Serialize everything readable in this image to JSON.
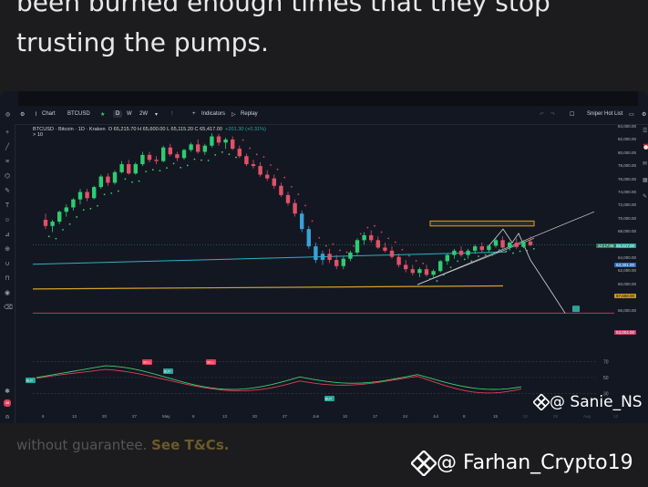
{
  "article": {
    "line1": "been burned enough times that they stop",
    "line2": "trusting the pumps.",
    "disclaimer_text": "without guarantee. ",
    "disclaimer_link": "See T&Cs."
  },
  "toolbar": {
    "chart_label": "Chart",
    "symbol": "BTCUSD",
    "interval_d": "D",
    "interval_w": "W",
    "interval_2w": "2W",
    "indicators_label": "Indicators",
    "replay_label": "Replay",
    "watchlist_label": "Sniper Hot List"
  },
  "legend": {
    "title": "BTCUSD · Bitcoin · 1D · Kraken",
    "ohlc": "O 65,215.70 H 65,600.00 L 65,115.20 C 65,417.00",
    "change": "+201.30 (+0.31%)",
    "sub": "> 10"
  },
  "price_axis": {
    "ticks": [
      "84,000.00",
      "82,000.00",
      "80,000.00",
      "78,000.00",
      "76,000.00",
      "74,000.00",
      "72,000.00",
      "70,000.00",
      "68,000.00",
      "66,000.00",
      "64,000.00",
      "62,000.00",
      "60,000.00",
      "58,000.00",
      "56,000.00"
    ],
    "tag_current": "65,417.00",
    "tag_green": "22:17:06",
    "tag_blue": "63,301.00",
    "tag_yellow": "57,658.00",
    "tag_pink": "53,004.00"
  },
  "osc_axis": {
    "ticks": [
      "70",
      "50",
      "30"
    ]
  },
  "osc_labels": {
    "sell1": "SELL",
    "sell2": "SELL",
    "buy1": "BUY",
    "buy2": "BUY",
    "buy3": "BUY"
  },
  "time_axis": {
    "labels": [
      "6",
      "13",
      "20",
      "27",
      "May",
      "6",
      "13",
      "20",
      "27",
      "Jun",
      "10",
      "17",
      "24",
      "Jul",
      "8",
      "15",
      "22",
      "29",
      "Aug",
      "12"
    ]
  },
  "watermarks": {
    "small": "@ Sanie_NS",
    "large": "@ Farhan_Crypto19"
  },
  "colors": {
    "up": "#26a69a",
    "down": "#ef5350",
    "bull_candle": "#2ecc71",
    "bear_candle": "#e05268",
    "trend_blue": "#2bb3c0",
    "support_yellow": "#d4a22a",
    "dots_red": "#e0405a",
    "dots_green": "#3ecf6a"
  },
  "chart_data": {
    "type": "candlestick",
    "title": "BTCUSD · Bitcoin · 1D · Kraken",
    "ylim": [
      54000,
      85000
    ],
    "candles": [
      [
        69500,
        70500,
        68000,
        68500
      ],
      [
        68500,
        69500,
        67500,
        69200
      ],
      [
        69200,
        71000,
        68800,
        70800
      ],
      [
        70800,
        72000,
        70000,
        71500
      ],
      [
        71500,
        73000,
        71000,
        72800
      ],
      [
        72800,
        74500,
        72000,
        74000
      ],
      [
        74000,
        74500,
        72500,
        73000
      ],
      [
        73000,
        75000,
        72800,
        74800
      ],
      [
        74800,
        76800,
        74500,
        76500
      ],
      [
        76500,
        77000,
        75000,
        75500
      ],
      [
        75500,
        77500,
        75200,
        77200
      ],
      [
        77200,
        79000,
        77000,
        78500
      ],
      [
        78500,
        79200,
        76800,
        77000
      ],
      [
        77000,
        78800,
        76800,
        78500
      ],
      [
        78500,
        80500,
        78200,
        80000
      ],
      [
        80000,
        80500,
        78800,
        79200
      ],
      [
        79200,
        79800,
        78500,
        79000
      ],
      [
        79000,
        81500,
        78800,
        81200
      ],
      [
        81200,
        81800,
        79800,
        80100
      ],
      [
        80100,
        80500,
        79000,
        79500
      ],
      [
        79500,
        81000,
        79200,
        80800
      ],
      [
        80800,
        82000,
        80500,
        81700
      ],
      [
        81700,
        82500,
        80200,
        80500
      ],
      [
        80500,
        81800,
        80000,
        81500
      ],
      [
        81500,
        83500,
        81200,
        83000
      ],
      [
        83000,
        83400,
        81500,
        82000
      ],
      [
        82000,
        82800,
        81000,
        82500
      ],
      [
        82500,
        83000,
        80800,
        81000
      ],
      [
        81000,
        81500,
        79500,
        79800
      ],
      [
        79800,
        80200,
        78200,
        78500
      ],
      [
        78500,
        79200,
        77800,
        78200
      ],
      [
        78200,
        78800,
        76500,
        76800
      ],
      [
        76800,
        77500,
        75800,
        76200
      ],
      [
        76200,
        76800,
        74500,
        75000
      ],
      [
        75000,
        75500,
        73200,
        73500
      ],
      [
        73500,
        74000,
        71800,
        72200
      ],
      [
        72200,
        72800,
        70000,
        70500
      ],
      [
        70500,
        71000,
        67500,
        68000
      ],
      [
        68000,
        68500,
        64800,
        65200
      ],
      [
        65200,
        65800,
        62500,
        63000
      ],
      [
        63000,
        64500,
        62200,
        64000
      ],
      [
        64000,
        64800,
        62500,
        63000
      ],
      [
        63000,
        63800,
        61500,
        62000
      ],
      [
        62000,
        63500,
        61500,
        63200
      ],
      [
        63200,
        64500,
        62800,
        64200
      ],
      [
        64200,
        66500,
        63800,
        66200
      ],
      [
        66200,
        67500,
        65500,
        67000
      ],
      [
        67000,
        67800,
        65800,
        66200
      ],
      [
        66200,
        66800,
        64800,
        65000
      ],
      [
        65000,
        65800,
        64200,
        64500
      ],
      [
        64500,
        65200,
        63200,
        63500
      ],
      [
        63500,
        64000,
        61800,
        62200
      ],
      [
        62200,
        63000,
        61000,
        61500
      ],
      [
        61500,
        62200,
        60500,
        60900
      ],
      [
        60900,
        61800,
        60200,
        61500
      ],
      [
        61500,
        62200,
        60300,
        60600
      ],
      [
        60600,
        61500,
        60000,
        61200
      ],
      [
        61200,
        63000,
        61000,
        62800
      ],
      [
        62800,
        64000,
        62200,
        63800
      ],
      [
        63800,
        64800,
        63200,
        64500
      ],
      [
        64500,
        65200,
        63500,
        63800
      ],
      [
        63800,
        64800,
        63200,
        64500
      ],
      [
        64500,
        65500,
        64000,
        65200
      ],
      [
        65200,
        65800,
        64200,
        64600
      ],
      [
        64600,
        65500,
        64200,
        65300
      ],
      [
        65300,
        66500,
        65000,
        66200
      ],
      [
        66200,
        66800,
        64800,
        65000
      ],
      [
        65000,
        66000,
        64500,
        65800
      ],
      [
        65800,
        66500,
        64800,
        65100
      ],
      [
        65100,
        66200,
        64900,
        66000
      ],
      [
        66000,
        66800,
        65200,
        65400
      ]
    ]
  }
}
